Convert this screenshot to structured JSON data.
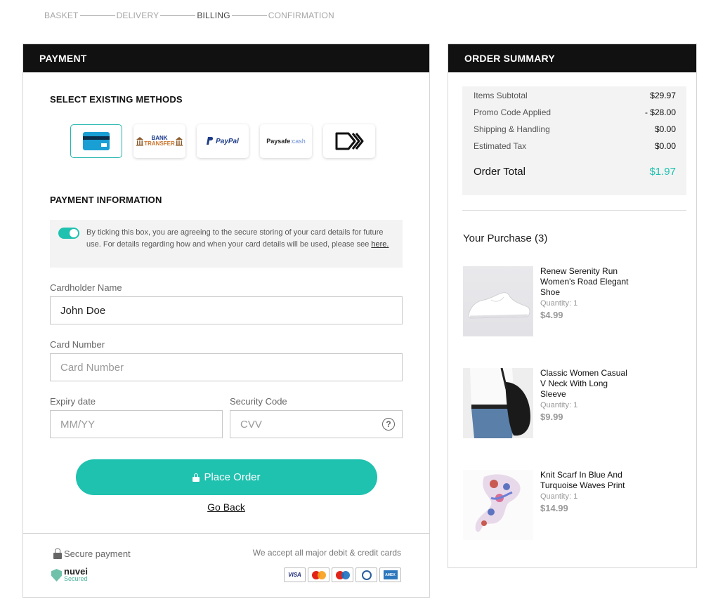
{
  "steps": [
    "BASKET",
    "DELIVERY",
    "BILLING",
    "CONFIRMATION"
  ],
  "active_step": "BILLING",
  "payment": {
    "title": "PAYMENT",
    "select_methods_title": "SELECT EXISTING METHODS",
    "methods": [
      {
        "name": "card",
        "label": ""
      },
      {
        "name": "bank-transfer",
        "label_top": "BANK",
        "label_bottom": "TRANSFER"
      },
      {
        "name": "paypal",
        "label": "PayPal"
      },
      {
        "name": "paysafecash",
        "label": "Paysafe",
        "label_suffix": ":cash"
      },
      {
        "name": "skrill",
        "label": ""
      }
    ],
    "info_title": "PAYMENT INFORMATION",
    "consent_text": "By ticking this box, you are agreeing to the secure storing of your card details for future use. For details regarding how and when your card details will be used, please see ",
    "consent_link": "here.",
    "cardholder": {
      "label": "Cardholder Name",
      "value": "John Doe"
    },
    "card_number": {
      "label": "Card Number",
      "placeholder": "Card Number"
    },
    "expiry": {
      "label": "Expiry date",
      "placeholder": "MM/YY"
    },
    "security": {
      "label": "Security Code",
      "placeholder": "CVV",
      "help": "?"
    },
    "place_order": "Place Order",
    "go_back": "Go Back",
    "secure_payment": "Secure payment",
    "nuvei_brand": "nuvei",
    "nuvei_sub": "Secured",
    "accept_text": "We accept all major debit & credit cards",
    "card_brands": [
      "VISA",
      "Mastercard",
      "Maestro",
      "Diners Club",
      "AMEX"
    ]
  },
  "summary": {
    "title": "ORDER SUMMARY",
    "rows": [
      {
        "label": "Items Subtotal",
        "value": "$29.97"
      },
      {
        "label": "Promo Code Applied",
        "value": "- $28.00"
      },
      {
        "label": "Shipping & Handling",
        "value": "$0.00"
      },
      {
        "label": "Estimated Tax",
        "value": "$0.00"
      }
    ],
    "order_total_label": "Order Total",
    "order_total_value": "$1.97",
    "purchase_title": "Your Purchase (3)",
    "items": [
      {
        "name": "Renew Serenity Run Women's Road Elegant Shoe",
        "qty": "Quantity: 1",
        "price": "$4.99"
      },
      {
        "name": "Classic Women Casual V Neck With Long Sleeve",
        "qty": "Quantity: 1",
        "price": "$9.99"
      },
      {
        "name": "Knit Scarf In Blue And Turquoise Waves Print",
        "qty": "Quantity: 1",
        "price": "$14.99"
      }
    ]
  },
  "colors": {
    "accent": "#1fc1af",
    "header": "#111111"
  }
}
